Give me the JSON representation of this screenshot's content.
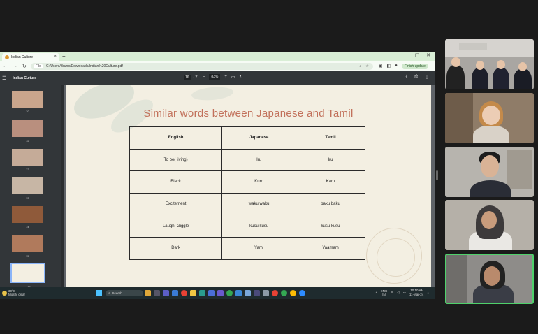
{
  "browser": {
    "tab_title": "Indian Culture",
    "tab_close": "×",
    "new_tab": "+",
    "window_controls": [
      "–",
      "▢",
      "✕"
    ],
    "nav": [
      "←",
      "→",
      "↻"
    ],
    "url_chip": "File",
    "url": "C:/Users/Bruno/Downloads/Indian%20Culture.pdf",
    "update_label": "Finish update"
  },
  "pdf": {
    "doc_title": "Indian Culture",
    "page_current": "16",
    "page_total": "/ 21",
    "zoom": "83%",
    "thumbnails": [
      {
        "num": "10",
        "color": "#c9a58c"
      },
      {
        "num": "11",
        "color": "#b98f7e"
      },
      {
        "num": "12",
        "color": "#c5ab98"
      },
      {
        "num": "13",
        "color": "#c7b6a5"
      },
      {
        "num": "14",
        "color": "#8f5a3a"
      },
      {
        "num": "15",
        "color": "#b07a5c"
      },
      {
        "num": "16",
        "color": "#f3efe2"
      }
    ]
  },
  "slide": {
    "title": "Similar words between Japanese and Tamil",
    "headers": [
      "English",
      "Japanese",
      "Tamil"
    ],
    "rows": [
      [
        "To be( living)",
        "Iru",
        "Iru"
      ],
      [
        "Black",
        "Kuro",
        "Karu"
      ],
      [
        "Excitement",
        "waku waku",
        "baku baku"
      ],
      [
        "Laugh, Giggle",
        "kusu kusu",
        "kusu kusu"
      ],
      [
        "Dark",
        "Yami",
        "Yaamam"
      ]
    ]
  },
  "taskbar": {
    "weather_temp": "30°C",
    "weather_desc": "Mostly clear",
    "search_placeholder": "Search",
    "lang": "ENG",
    "lang_sub": "IN",
    "time": "10:10 AM",
    "date": "11-Mar-24"
  },
  "colors": {
    "title": "#c2715b",
    "active_speaker": "#4fd16b",
    "tab_strip": "#d9eed6"
  }
}
